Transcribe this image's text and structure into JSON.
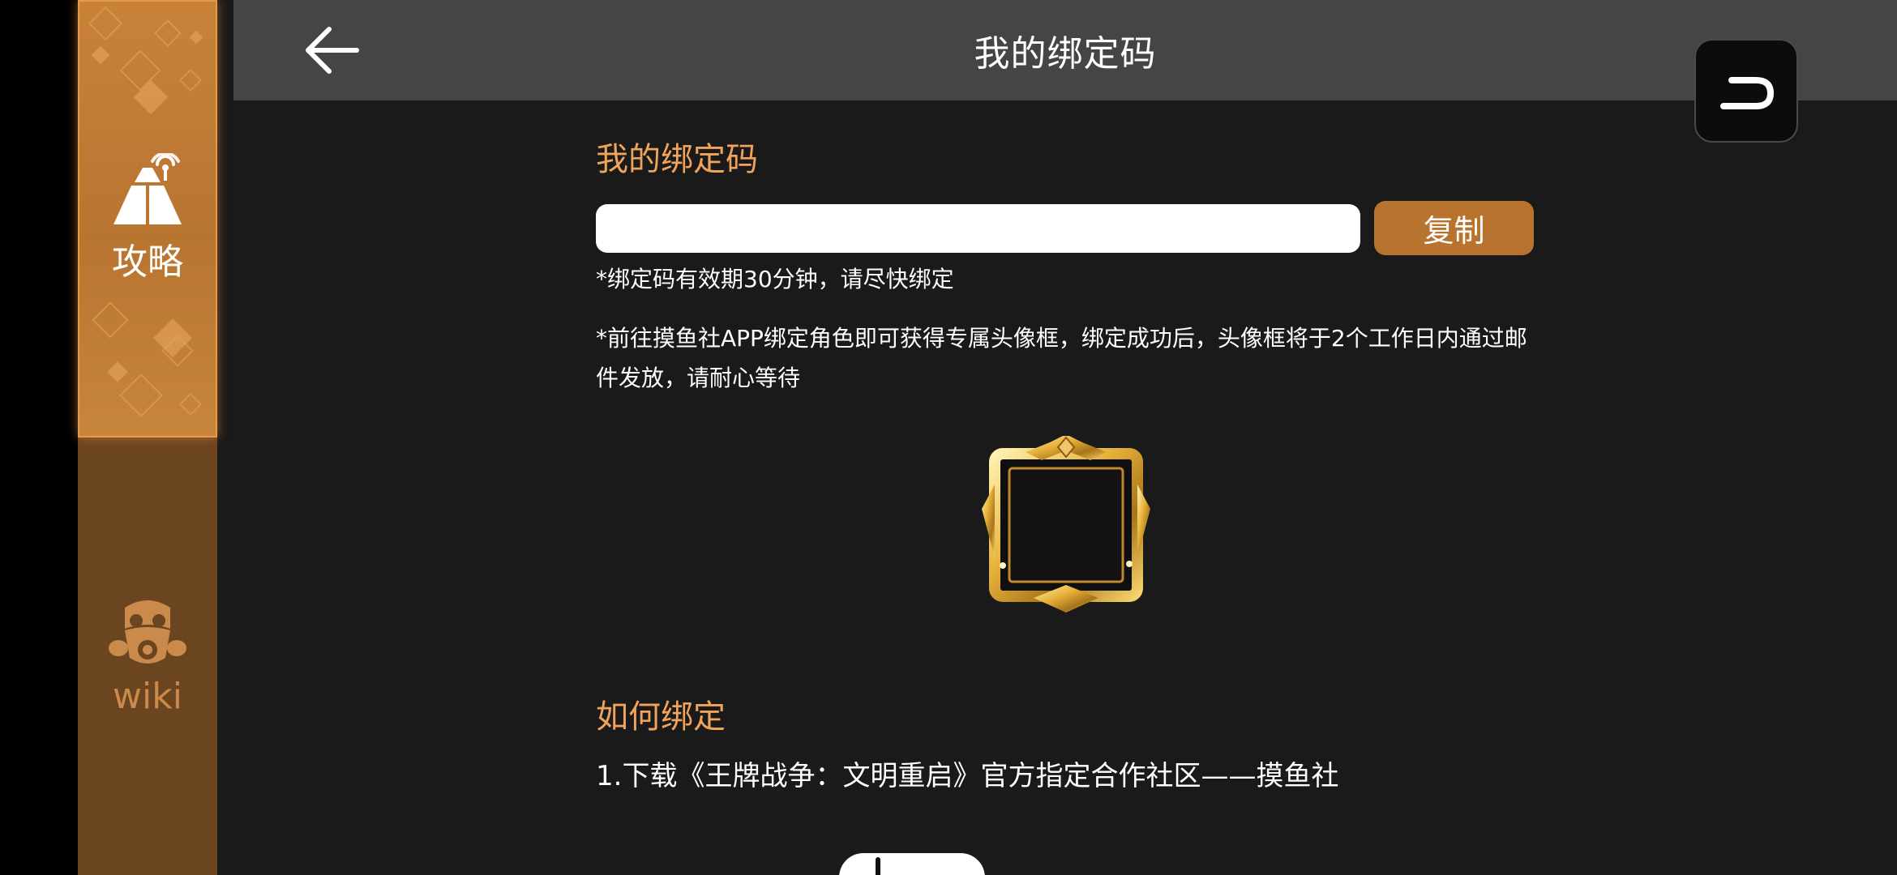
{
  "sidebar": {
    "tabs": [
      {
        "label": "攻略",
        "icon": "tent-signal-icon",
        "active": true
      },
      {
        "label": "wiki",
        "icon": "gas-mask-icon",
        "active": false
      }
    ],
    "active_color": "#c8823a",
    "inactive_color": "#6b4420"
  },
  "header": {
    "title": "我的绑定码",
    "back_icon": "back-arrow-icon"
  },
  "float_button": {
    "icon": "return-icon"
  },
  "bind_code": {
    "section_title": "我的绑定码",
    "code_value": "",
    "copy_label": "复制",
    "validity_note": "*绑定码有效期30分钟，请尽快绑定",
    "reward_note": "*前往摸鱼社APP绑定角色即可获得专属头像框，绑定成功后，头像框将于2个工作日内通过邮件发放，请耐心等待"
  },
  "reward_image": {
    "icon": "golden-avatar-frame-icon"
  },
  "how_to": {
    "title": "如何绑定",
    "steps": [
      "1.下载《王牌战争：文明重启》官方指定合作社区——摸鱼社"
    ]
  },
  "colors": {
    "accent": "#f0a35a",
    "button": "#b8732f",
    "header_bg": "#454545",
    "page_bg": "#1a1a1a"
  }
}
